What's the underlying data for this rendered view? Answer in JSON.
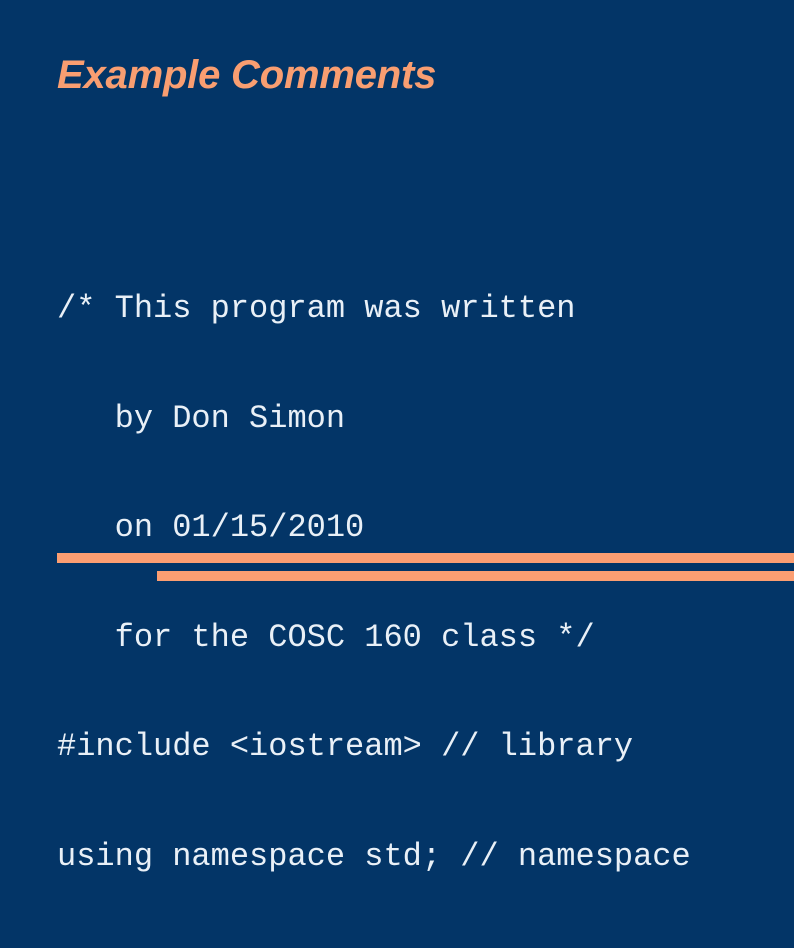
{
  "slide": {
    "background_color": "#033567",
    "title": "Example Comments",
    "title_color": "#f99e71",
    "body_text_color": "#e9f0f7",
    "accent_color": "#fb9e72",
    "code": {
      "language": "cpp",
      "lines": [
        "/* This program was written",
        "   by Don Simon",
        "   on 01/15/2010",
        "   for the COSC 160 class */",
        "#include <iostream> // library",
        "using namespace std; // namespace"
      ]
    },
    "decorations": [
      {
        "name": "upper-rule",
        "color": "#fb9e72"
      },
      {
        "name": "lower-rule",
        "color": "#fb9e72"
      }
    ]
  }
}
